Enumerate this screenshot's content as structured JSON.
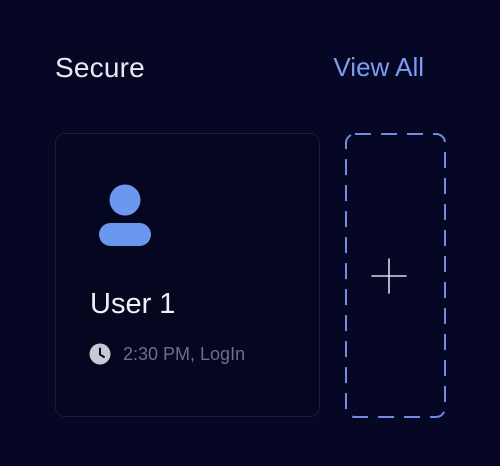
{
  "header": {
    "title": "Secure",
    "view_all_label": "View All"
  },
  "cards": [
    {
      "name": "User 1",
      "activity": "2:30 PM, LogIn",
      "avatar_icon": "user-icon",
      "activity_icon": "clock-icon"
    }
  ],
  "add_card": {
    "icon": "plus-icon"
  },
  "colors": {
    "background": "#060724",
    "accent": "#7b9cf0",
    "avatar": "#6c97f0",
    "text_primary": "#eef0f8",
    "text_muted": "#6c6f89",
    "card_border": "#1a1c3b",
    "dashed_border": "#6f8ee0"
  }
}
